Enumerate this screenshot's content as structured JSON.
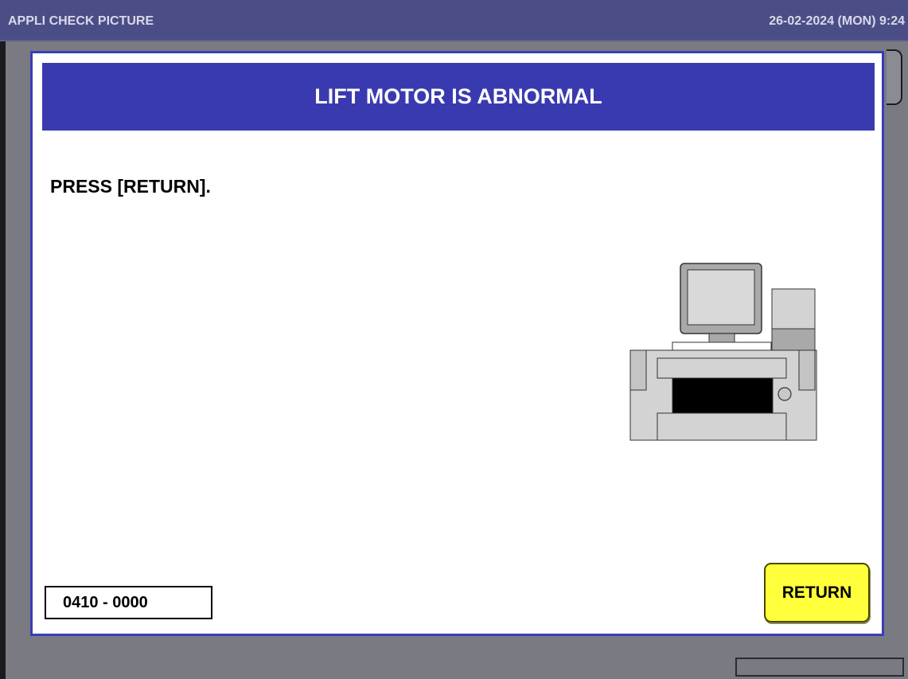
{
  "window": {
    "title": "APPLI CHECK PICTURE",
    "datetime": "26-02-2024 (MON)  9:24"
  },
  "dialog": {
    "header": "LIFT MOTOR IS ABNORMAL",
    "instruction": "PRESS [RETURN].",
    "error_code": "0410 - 0000",
    "return_label": "RETURN",
    "illustration": "printer-machine-icon"
  },
  "colors": {
    "titlebar": "#4b4e86",
    "dialog_header": "#3a3ab0",
    "dialog_border": "#3a3db6",
    "return_button": "#ffff3c",
    "background": "#7a7a82"
  }
}
